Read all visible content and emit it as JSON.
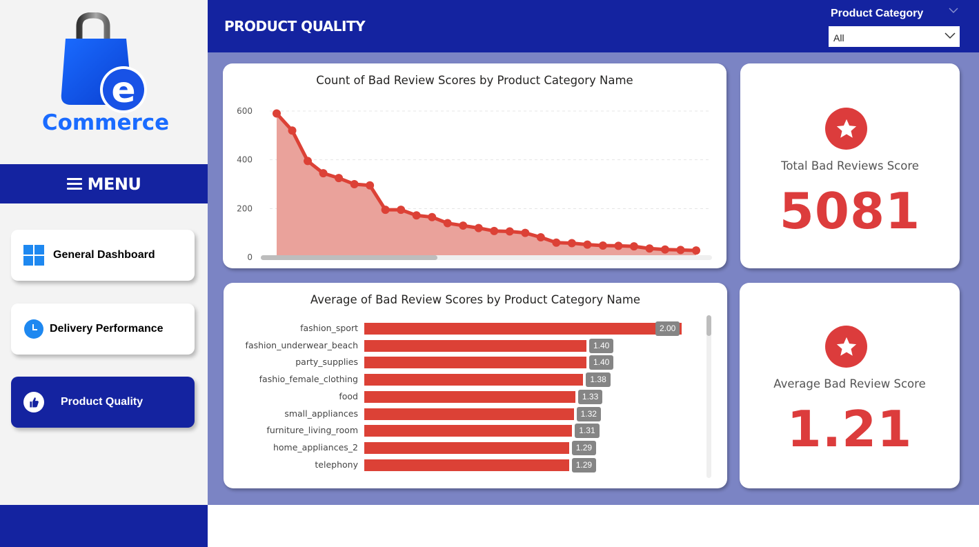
{
  "app": {
    "logo_text_e": "e",
    "logo_text": "Commerce"
  },
  "sidebar": {
    "menu_label": "MENU",
    "items": [
      {
        "label": "General Dashboard",
        "icon": "windows-grid-icon",
        "active": false
      },
      {
        "label": "Delivery Performance",
        "icon": "clock-icon",
        "active": false
      },
      {
        "label": "Product Quality",
        "icon": "thumbs-up-icon",
        "active": true
      }
    ]
  },
  "header": {
    "title": "PRODUCT QUALITY",
    "filter": {
      "label": "Product Category",
      "value": "All"
    }
  },
  "colors": {
    "brand": "#1423a0",
    "accent_red": "#dc3c3c",
    "background": "#7b84c4",
    "label_badge": "#858585"
  },
  "kpis": [
    {
      "label": "Total Bad Reviews Score",
      "value": "5081",
      "icon": "star-icon"
    },
    {
      "label": "Average Bad Review Score",
      "value": "1.21",
      "icon": "star-icon"
    }
  ],
  "chart_data": [
    {
      "type": "area",
      "title": "Count of Bad Review Scores by Product Category Name",
      "xlabel": "",
      "ylabel": "",
      "ylim": [
        0,
        600
      ],
      "yticks": [
        0,
        200,
        400,
        600
      ],
      "grid": true,
      "values": [
        590,
        520,
        395,
        345,
        325,
        300,
        295,
        195,
        195,
        172,
        165,
        140,
        130,
        120,
        108,
        106,
        100,
        82,
        60,
        58,
        52,
        48,
        47,
        45,
        36,
        32,
        30,
        28
      ]
    },
    {
      "type": "bar",
      "orientation": "horizontal",
      "title": "Average of Bad Review Scores by Product Category Name",
      "xlim": [
        0,
        2
      ],
      "categories": [
        "fashion_sport",
        "fashion_underwear_beach",
        "party_supplies",
        "fashio_female_clothing",
        "food",
        "small_appliances",
        "furniture_living_room",
        "home_appliances_2",
        "telephony"
      ],
      "values": [
        2.0,
        1.4,
        1.4,
        1.38,
        1.33,
        1.32,
        1.31,
        1.29,
        1.29
      ],
      "value_labels": [
        "2.00",
        "1.40",
        "1.40",
        "1.38",
        "1.33",
        "1.32",
        "1.31",
        "1.29",
        "1.29"
      ]
    }
  ]
}
